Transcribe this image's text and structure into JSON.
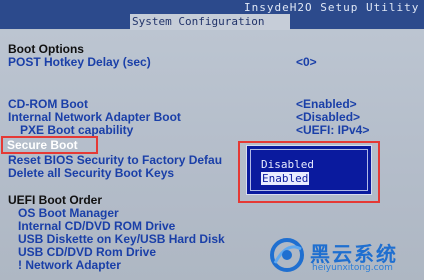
{
  "header": {
    "utility_title": "InsydeH2O Setup Utility",
    "active_tab": "System Configuration"
  },
  "sections": {
    "boot_options": {
      "header": "Boot Options",
      "post_hotkey_delay": {
        "label": "POST Hotkey Delay (sec)",
        "value": "<0>"
      },
      "cd_rom_boot": {
        "label": "CD-ROM Boot",
        "value": "<Enabled>"
      },
      "internal_network_adapter_boot": {
        "label": "Internal Network Adapter Boot",
        "value": "<Disabled>"
      },
      "pxe_boot_capability": {
        "label": "PXE Boot capability",
        "value": "<UEFI: IPv4>"
      },
      "secure_boot": {
        "label": "Secure Boot"
      },
      "reset_bios_security": {
        "label": "Reset BIOS Security to Factory Defau"
      },
      "delete_all_secure_boot_keys": {
        "label": "Delete all Security Boot Keys"
      }
    },
    "uefi_boot_order": {
      "header": "UEFI Boot Order",
      "items": [
        "OS Boot Manager",
        "Internal CD/DVD ROM Drive",
        "USB Diskette on Key/USB Hard Disk",
        "USB CD/DVD Rom Drive",
        "! Network Adapter"
      ]
    }
  },
  "popup": {
    "options": [
      "Disabled",
      "Enabled"
    ],
    "selected": "Enabled"
  },
  "watermark": {
    "brand": "黑云系统",
    "url": "heiyunxitong.com"
  },
  "colors": {
    "title_bar": "#2c4a8c",
    "item_text": "#1a3fa8",
    "popup_bg": "#0a1a9e",
    "highlight_outline": "#e53935"
  }
}
